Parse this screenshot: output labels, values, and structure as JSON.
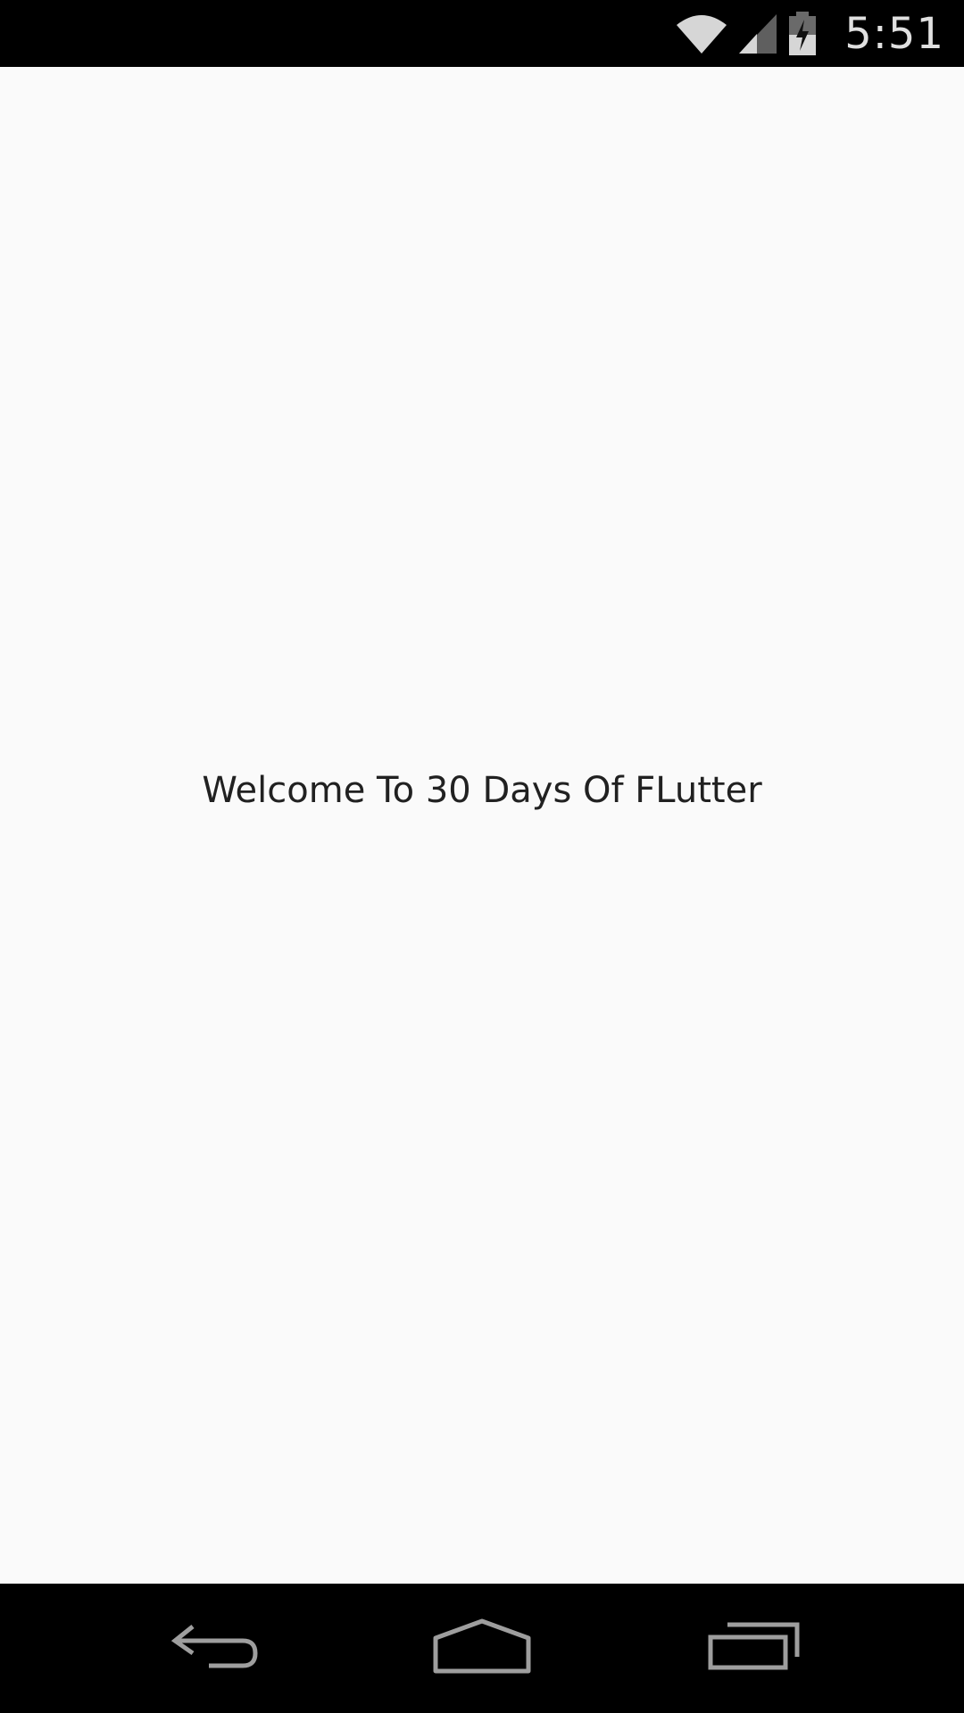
{
  "status_bar": {
    "time": "5:51",
    "icons": [
      "wifi-icon",
      "cellular-signal-icon",
      "battery-charging-icon"
    ],
    "background": "#000000"
  },
  "main": {
    "welcome_text": "Welcome To 30 Days Of FLutter",
    "background": "#fafafa",
    "text_color": "#212121"
  },
  "nav_bar": {
    "buttons": [
      "back-icon",
      "home-icon",
      "recent-apps-icon"
    ],
    "background": "#000000",
    "icon_color": "#9e9e9e"
  }
}
